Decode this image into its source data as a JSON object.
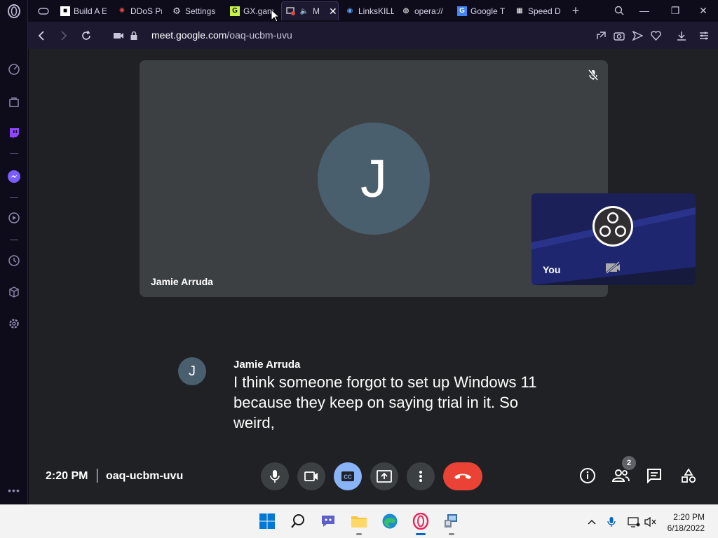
{
  "browser": {
    "tabs": [
      {
        "title": "Build A E",
        "icon": "roblox-icon",
        "active": false
      },
      {
        "title": "DDoS Pr",
        "icon": "ddos-icon",
        "active": false
      },
      {
        "title": "Settings",
        "icon": "gear-icon",
        "active": false
      },
      {
        "title": "GX.gam",
        "icon": "gx-games-icon",
        "active": false
      },
      {
        "title": "M",
        "icon": "meet-icon",
        "active": true
      },
      {
        "title": "LinksKILL",
        "icon": "links-icon",
        "active": false
      },
      {
        "title": "opera://",
        "icon": "globe-icon",
        "active": false
      },
      {
        "title": "Google T",
        "icon": "google-translate-icon",
        "active": false
      },
      {
        "title": "Speed D",
        "icon": "speed-dial-icon",
        "active": false
      }
    ],
    "url_host": "meet.google.com",
    "url_path": "/oaq-ucbm-uvu"
  },
  "meet": {
    "main_participant": {
      "name": "Jamie Arruda",
      "initial": "J"
    },
    "self_tile": {
      "name": "You"
    },
    "caption": {
      "speaker": "Jamie Arruda",
      "initial": "J",
      "text": "I think someone forgot to set up Windows 11 because they keep on saying trial in it. So weird,"
    },
    "bottom_bar": {
      "time": "2:20 PM",
      "meeting_code": "oaq-ucbm-uvu",
      "participant_count": "2"
    },
    "colors": {
      "accent_cc": "#8ab4f8",
      "end_call": "#ea4335",
      "tile_bg": "#3c4043",
      "page_bg": "#202124"
    }
  },
  "taskbar": {
    "time": "2:20 PM",
    "date": "6/18/2022",
    "apps": [
      "windows-start-icon",
      "search-icon",
      "chat-icon",
      "file-explorer-icon",
      "edge-icon",
      "opera-gx-icon",
      "network-app-icon"
    ]
  }
}
